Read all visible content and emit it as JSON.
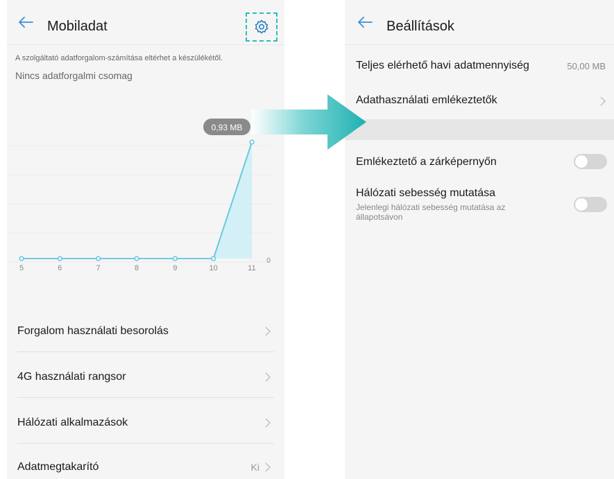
{
  "left": {
    "title": "Mobiladat",
    "disclaimer": "A szolgáltató adatforgalom-számítása eltérhet a készülékétől.",
    "package": "Nincs adatforgalmi csomag",
    "chart_data": {
      "type": "area",
      "x": [
        "5",
        "6",
        "7",
        "8",
        "9",
        "10",
        "11"
      ],
      "values": [
        0,
        0,
        0,
        0,
        0,
        0,
        0.93
      ],
      "tooltip": "0,93 MB",
      "zero_label": "0",
      "colors": {
        "line": "#5cc4e0",
        "fill": "#cceef7",
        "tooltip_bg": "#8a8a8a"
      }
    },
    "rows": [
      {
        "label": "Forgalom használati besorolás",
        "value": ""
      },
      {
        "label": "4G használati rangsor",
        "value": ""
      },
      {
        "label": "Hálózati alkalmazások",
        "value": ""
      },
      {
        "label": "Adatmegtakarító",
        "value": "Ki"
      }
    ]
  },
  "right": {
    "title": "Beállítások",
    "total_label": "Teljes elérhető havi adatmennyiség",
    "total_value": "50,00 MB",
    "reminders_label": "Adathasználati emlékeztetők",
    "lockscreen_label": "Emlékeztető a zárképernyőn",
    "speed_label": "Hálózati sebesség mutatása",
    "speed_sub": "Jelenlegi hálózati sebesség mutatása az állapotsávon"
  },
  "icons": {
    "back": "arrow-left-icon",
    "settings": "gear-icon",
    "chevron": "chevron-right-icon",
    "flow": "arrow-right-icon"
  },
  "colors": {
    "accent": "#2bbcbc",
    "back_arrow": "#3a8fd8"
  }
}
